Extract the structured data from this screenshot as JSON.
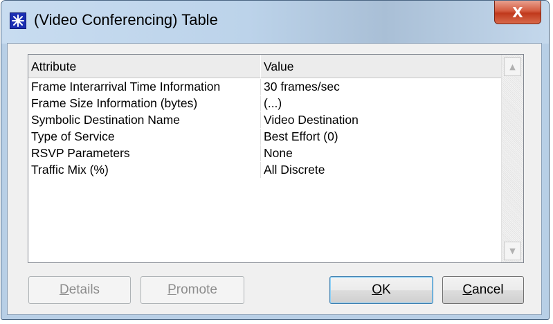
{
  "window": {
    "title": "(Video Conferencing) Table",
    "close_label": "X"
  },
  "table": {
    "columns": [
      "Attribute",
      "Value"
    ],
    "rows": [
      {
        "attribute": "Frame Interarrival Time Information",
        "value": "30 frames/sec"
      },
      {
        "attribute": "Frame Size Information (bytes)",
        "value": "(...)"
      },
      {
        "attribute": "Symbolic Destination Name",
        "value": "Video Destination"
      },
      {
        "attribute": "Type of Service",
        "value": "Best Effort (0)"
      },
      {
        "attribute": "RSVP Parameters",
        "value": "None"
      },
      {
        "attribute": "Traffic Mix (%)",
        "value": "All Discrete"
      }
    ]
  },
  "buttons": {
    "details": {
      "mnemonic": "D",
      "rest": "etails"
    },
    "promote": {
      "mnemonic": "P",
      "rest": "romote"
    },
    "ok": {
      "mnemonic": "O",
      "rest": "K"
    },
    "cancel": {
      "mnemonic": "C",
      "rest": "ancel"
    }
  },
  "icons": {
    "app": "asterisk-icon",
    "close": "close-icon",
    "scroll_up": "scroll-up-arrow-icon",
    "scroll_down": "scroll-down-arrow-icon"
  }
}
